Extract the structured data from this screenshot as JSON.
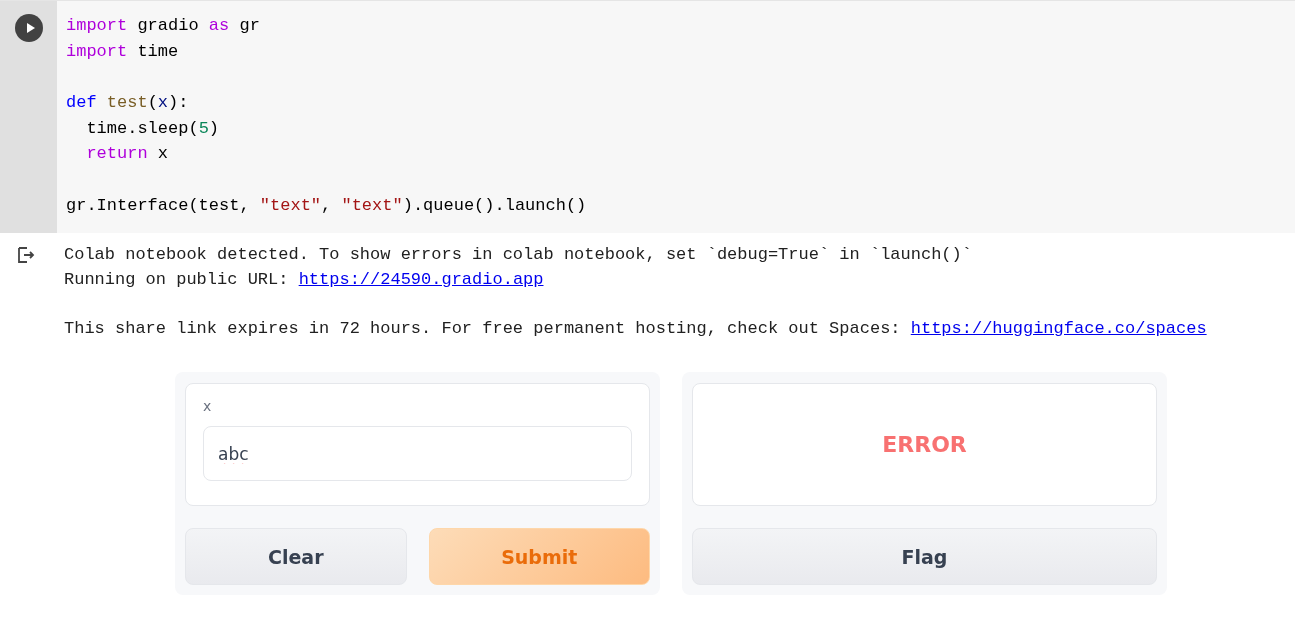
{
  "code_cell": {
    "lines": [
      {
        "gap_before": false,
        "tokens": [
          {
            "text": "import",
            "kind": "keyword"
          },
          {
            "text": " gradio ",
            "kind": "plain"
          },
          {
            "text": "as",
            "kind": "keyword"
          },
          {
            "text": " gr",
            "kind": "plain"
          }
        ]
      },
      {
        "gap_before": false,
        "tokens": [
          {
            "text": "import",
            "kind": "keyword"
          },
          {
            "text": " time",
            "kind": "plain"
          }
        ]
      },
      {
        "gap_before": true,
        "tokens": [
          {
            "text": "def",
            "kind": "def"
          },
          {
            "text": " test",
            "kind": "func"
          },
          {
            "text": "(",
            "kind": "plain"
          },
          {
            "text": "x",
            "kind": "param"
          },
          {
            "text": "):",
            "kind": "plain"
          }
        ]
      },
      {
        "gap_before": false,
        "tokens": [
          {
            "text": "  time.sleep(",
            "kind": "plain"
          },
          {
            "text": "5",
            "kind": "number"
          },
          {
            "text": ")",
            "kind": "plain"
          }
        ]
      },
      {
        "gap_before": false,
        "tokens": [
          {
            "text": "  return",
            "kind": "keyword"
          },
          {
            "text": " x",
            "kind": "plain"
          }
        ]
      },
      {
        "gap_before": true,
        "tokens": [
          {
            "text": "gr.Interface(test, ",
            "kind": "plain"
          },
          {
            "text": "\"text\"",
            "kind": "string"
          },
          {
            "text": ", ",
            "kind": "plain"
          },
          {
            "text": "\"text\"",
            "kind": "string"
          },
          {
            "text": ").queue().launch()",
            "kind": "plain"
          }
        ]
      }
    ]
  },
  "output": {
    "lines": [
      {
        "gap_before": false,
        "text": "Colab notebook detected. To show errors in colab notebook, set `debug=True` in `launch()`"
      },
      {
        "gap_before": false,
        "text": "Running on public URL: ",
        "link": "https://24590.gradio.app"
      },
      {
        "gap_before": true,
        "text": "This share link expires in 72 hours. For free permanent hosting, check out Spaces: ",
        "link": "https://huggingface.co/spaces"
      }
    ]
  },
  "interface": {
    "input": {
      "label": "x",
      "value": "abc"
    },
    "buttons": [
      "Clear",
      "Submit"
    ],
    "output": {
      "value": "ERROR"
    },
    "flag_button": "Flag"
  }
}
